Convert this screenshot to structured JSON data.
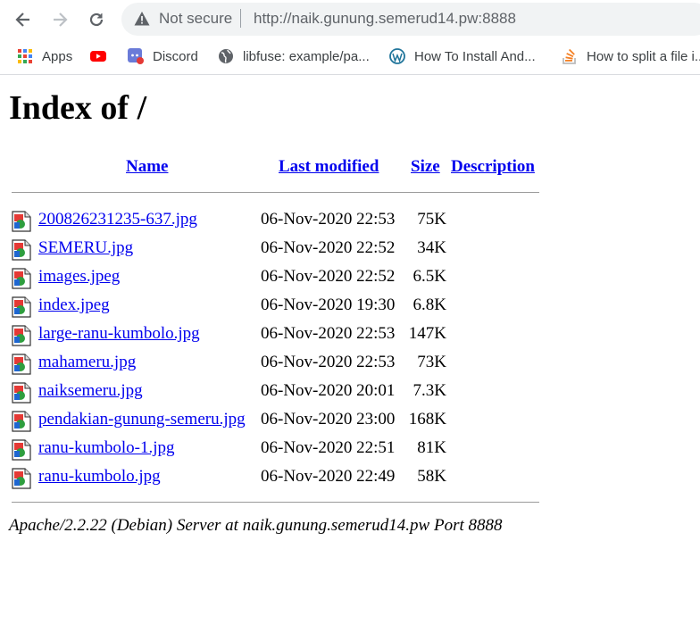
{
  "browser": {
    "security_label": "Not secure",
    "url": "http://naik.gunung.semerud14.pw:8888",
    "bookmarks": [
      {
        "label": "Apps",
        "icon": "apps-grid-icon"
      },
      {
        "label": "",
        "icon": "youtube-icon"
      },
      {
        "label": "Discord",
        "icon": "discord-icon"
      },
      {
        "label": "libfuse: example/pa...",
        "icon": "globe-icon"
      },
      {
        "label": "How To Install And...",
        "icon": "wordpress-icon"
      },
      {
        "label": "How to split a file i...",
        "icon": "stackoverflow-icon"
      }
    ]
  },
  "page": {
    "title": "Index of /",
    "columns": {
      "name": "Name",
      "last_modified": "Last modified",
      "size": "Size",
      "description": "Description"
    },
    "files": [
      {
        "name": "200826231235-637.jpg",
        "modified": "06-Nov-2020 22:53",
        "size": "75K"
      },
      {
        "name": "SEMERU.jpg",
        "modified": "06-Nov-2020 22:52",
        "size": "34K"
      },
      {
        "name": "images.jpeg",
        "modified": "06-Nov-2020 22:52",
        "size": "6.5K"
      },
      {
        "name": "index.jpeg",
        "modified": "06-Nov-2020 19:30",
        "size": "6.8K"
      },
      {
        "name": "large-ranu-kumbolo.jpg",
        "modified": "06-Nov-2020 22:53",
        "size": "147K"
      },
      {
        "name": "mahameru.jpg",
        "modified": "06-Nov-2020 22:53",
        "size": "73K"
      },
      {
        "name": "naiksemeru.jpg",
        "modified": "06-Nov-2020 20:01",
        "size": "7.3K"
      },
      {
        "name": "pendakian-gunung-semeru.jpg",
        "modified": "06-Nov-2020 23:00",
        "size": "168K"
      },
      {
        "name": "ranu-kumbolo-1.jpg",
        "modified": "06-Nov-2020 22:51",
        "size": "81K"
      },
      {
        "name": "ranu-kumbolo.jpg",
        "modified": "06-Nov-2020 22:49",
        "size": "58K"
      }
    ],
    "footer": "Apache/2.2.22 (Debian) Server at naik.gunung.semerud14.pw Port 8888"
  },
  "colors": {
    "link": "#0000ee",
    "omnibox_bg": "#f1f3f4"
  }
}
